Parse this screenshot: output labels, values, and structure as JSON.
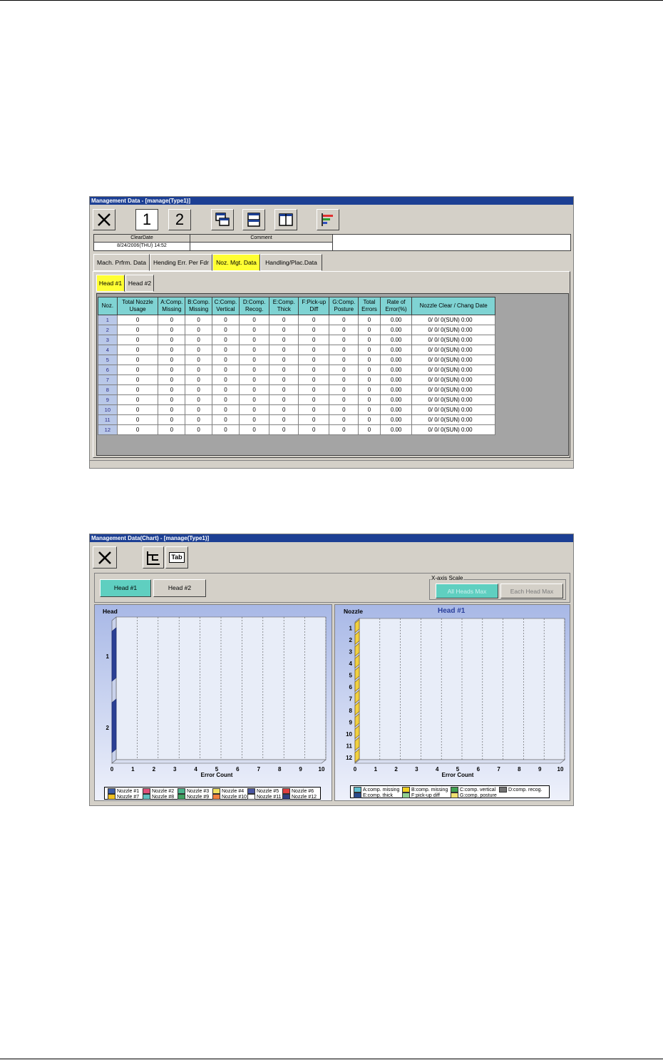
{
  "window1": {
    "title": "Management Data - [manage(Type1)]",
    "toolbar": {
      "btn1": "1",
      "btn2": "2"
    },
    "clear_date_label": "ClearDate",
    "clear_date_value": "8/24/2006(THU) 14:52",
    "comment_label": "Comment",
    "comment_value": "",
    "tabs": [
      "Mach. Prfrm. Data",
      "Hending Err. Per Fdr",
      "Noz. Mgt. Data",
      "Handling/Plac.Data"
    ],
    "active_tab": "Noz. Mgt. Data",
    "head_tabs": [
      "Head #1",
      "Head #2"
    ],
    "table": {
      "headers": [
        "Noz.",
        "Total Nozzle Usage",
        "A:Comp. Missing",
        "B:Comp. Missing",
        "C:Comp. Vertical",
        "D:Comp. Recog.",
        "E:Comp. Thick",
        "F:Pick-up Diff",
        "G:Comp. Posture",
        "Total Errors",
        "Rate of Error(%)",
        "Nozzle Clear / Chang Date"
      ],
      "rows": [
        [
          "1",
          "0",
          "0",
          "0",
          "0",
          "0",
          "0",
          "0",
          "0",
          "0",
          "0.00",
          "0/ 0/  0(SUN) 0:00"
        ],
        [
          "2",
          "0",
          "0",
          "0",
          "0",
          "0",
          "0",
          "0",
          "0",
          "0",
          "0.00",
          "0/ 0/  0(SUN) 0:00"
        ],
        [
          "3",
          "0",
          "0",
          "0",
          "0",
          "0",
          "0",
          "0",
          "0",
          "0",
          "0.00",
          "0/ 0/  0(SUN) 0:00"
        ],
        [
          "4",
          "0",
          "0",
          "0",
          "0",
          "0",
          "0",
          "0",
          "0",
          "0",
          "0.00",
          "0/ 0/  0(SUN) 0:00"
        ],
        [
          "5",
          "0",
          "0",
          "0",
          "0",
          "0",
          "0",
          "0",
          "0",
          "0",
          "0.00",
          "0/ 0/  0(SUN) 0:00"
        ],
        [
          "6",
          "0",
          "0",
          "0",
          "0",
          "0",
          "0",
          "0",
          "0",
          "0",
          "0.00",
          "0/ 0/  0(SUN) 0:00"
        ],
        [
          "7",
          "0",
          "0",
          "0",
          "0",
          "0",
          "0",
          "0",
          "0",
          "0",
          "0.00",
          "0/ 0/  0(SUN) 0:00"
        ],
        [
          "8",
          "0",
          "0",
          "0",
          "0",
          "0",
          "0",
          "0",
          "0",
          "0",
          "0.00",
          "0/ 0/  0(SUN) 0:00"
        ],
        [
          "9",
          "0",
          "0",
          "0",
          "0",
          "0",
          "0",
          "0",
          "0",
          "0",
          "0.00",
          "0/ 0/  0(SUN) 0:00"
        ],
        [
          "10",
          "0",
          "0",
          "0",
          "0",
          "0",
          "0",
          "0",
          "0",
          "0",
          "0.00",
          "0/ 0/  0(SUN) 0:00"
        ],
        [
          "11",
          "0",
          "0",
          "0",
          "0",
          "0",
          "0",
          "0",
          "0",
          "0",
          "0.00",
          "0/ 0/  0(SUN) 0:00"
        ],
        [
          "12",
          "0",
          "0",
          "0",
          "0",
          "0",
          "0",
          "0",
          "0",
          "0",
          "0.00",
          "0/ 0/  0(SUN) 0:00"
        ]
      ]
    }
  },
  "window2": {
    "title": "Management Data(Chart) - [manage(Type1)]",
    "toolbar_tab_label": "Tab",
    "head_buttons": [
      "Head #1",
      "Head #2"
    ],
    "active_head": "Head #1",
    "xaxis_group_label": "X-axis Scale",
    "xaxis_buttons": [
      "All Heads Max",
      "Each Head Max"
    ],
    "left_panel": {
      "title": "Head",
      "xlabel": "Error Count"
    },
    "right_panel": {
      "title": "Nozzle",
      "subtitle": "Head #1",
      "xlabel": "Error Count"
    }
  },
  "colors": {
    "title_bar": "#1c3f94",
    "header_cyan": "#7fd3d3",
    "active_tab_yellow": "#ffff33",
    "active_head_button": "#5fcfc0"
  },
  "chart_data": [
    {
      "type": "bar",
      "orientation": "horizontal",
      "title": "Head",
      "xlabel": "Error Count",
      "ylabel": "",
      "categories": [
        "1",
        "2"
      ],
      "xlim": [
        0,
        10
      ],
      "x_ticks": [
        "0",
        "1",
        "2",
        "3",
        "4",
        "5",
        "6",
        "7",
        "8",
        "9",
        "10"
      ],
      "series": [
        {
          "name": "Nozzle #1",
          "color": "#3b5ba8",
          "values": [
            0,
            0
          ]
        },
        {
          "name": "Nozzle #2",
          "color": "#e0507a",
          "values": [
            0,
            0
          ]
        },
        {
          "name": "Nozzle #3",
          "color": "#49b38a",
          "values": [
            0,
            0
          ]
        },
        {
          "name": "Nozzle #4",
          "color": "#f0e060",
          "values": [
            0,
            0
          ]
        },
        {
          "name": "Nozzle #5",
          "color": "#4a55a0",
          "values": [
            0,
            0
          ]
        },
        {
          "name": "Nozzle #6",
          "color": "#e04040",
          "values": [
            0,
            0
          ]
        },
        {
          "name": "Nozzle #7",
          "color": "#f0c020",
          "values": [
            0,
            0
          ]
        },
        {
          "name": "Nozzle #8",
          "color": "#60c0c0",
          "values": [
            0,
            0
          ]
        },
        {
          "name": "Nozzle #9",
          "color": "#40a060",
          "values": [
            0,
            0
          ]
        },
        {
          "name": "Nozzle #10",
          "color": "#f08040",
          "values": [
            0,
            0
          ]
        },
        {
          "name": "Nozzle #11",
          "color": "#ffffff",
          "values": [
            0,
            0
          ]
        },
        {
          "name": "Nozzle #12",
          "color": "#304080",
          "values": [
            0,
            0
          ]
        }
      ],
      "legend": "bottom",
      "grid": true
    },
    {
      "type": "bar",
      "orientation": "horizontal",
      "title": "Nozzle",
      "subtitle": "Head #1",
      "xlabel": "Error Count",
      "ylabel": "",
      "categories": [
        "1",
        "2",
        "3",
        "4",
        "5",
        "6",
        "7",
        "8",
        "9",
        "10",
        "11",
        "12"
      ],
      "xlim": [
        0,
        10
      ],
      "x_ticks": [
        "0",
        "1",
        "2",
        "3",
        "4",
        "5",
        "6",
        "7",
        "8",
        "9",
        "10"
      ],
      "series": [
        {
          "name": "A:comp. missing",
          "color": "#60c0d0",
          "values": [
            0,
            0,
            0,
            0,
            0,
            0,
            0,
            0,
            0,
            0,
            0,
            0
          ]
        },
        {
          "name": "B:comp. missing",
          "color": "#f0d020",
          "values": [
            0,
            0,
            0,
            0,
            0,
            0,
            0,
            0,
            0,
            0,
            0,
            0
          ]
        },
        {
          "name": "C:comp. vertical",
          "color": "#40a050",
          "values": [
            0,
            0,
            0,
            0,
            0,
            0,
            0,
            0,
            0,
            0,
            0,
            0
          ]
        },
        {
          "name": "D:comp. recog.",
          "color": "#707070",
          "values": [
            0,
            0,
            0,
            0,
            0,
            0,
            0,
            0,
            0,
            0,
            0,
            0
          ]
        },
        {
          "name": "E:comp. thick",
          "color": "#2a4a8a",
          "values": [
            0,
            0,
            0,
            0,
            0,
            0,
            0,
            0,
            0,
            0,
            0,
            0
          ]
        },
        {
          "name": "F:pick-up diff",
          "color": "#90d090",
          "values": [
            0,
            0,
            0,
            0,
            0,
            0,
            0,
            0,
            0,
            0,
            0,
            0
          ]
        },
        {
          "name": "G:comp. posture",
          "color": "#f0e070",
          "values": [
            0,
            0,
            0,
            0,
            0,
            0,
            0,
            0,
            0,
            0,
            0,
            0
          ]
        }
      ],
      "legend": "bottom",
      "grid": true
    }
  ]
}
